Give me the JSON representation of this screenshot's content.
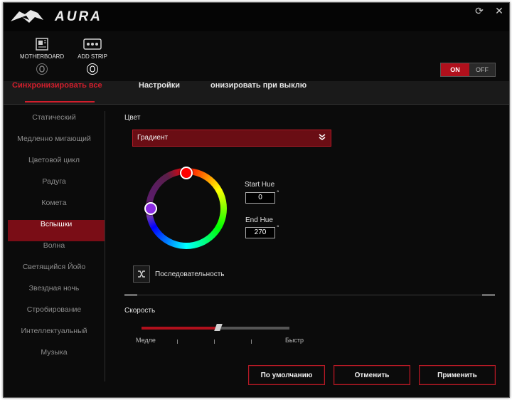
{
  "app": {
    "title": "AURA"
  },
  "devices": [
    {
      "label": "MOTHERBOARD",
      "icon": "motherboard-icon"
    },
    {
      "label": "ADD STRIP",
      "icon": "led-strip-icon"
    }
  ],
  "power": {
    "on": "ON",
    "off": "OFF",
    "state": "on"
  },
  "tabs": [
    {
      "label": "Синхронизировать все",
      "active": true
    },
    {
      "label": "Настройки",
      "active": false
    },
    {
      "label": "онизировать при выклю",
      "active": false
    }
  ],
  "sidebar": {
    "items": [
      {
        "label": "Статический"
      },
      {
        "label": "Медленно мигающий"
      },
      {
        "label": "Цветовой цикл"
      },
      {
        "label": "Радуга"
      },
      {
        "label": "Комета"
      },
      {
        "label": "Вспышки",
        "active": true
      },
      {
        "label": "Волна"
      },
      {
        "label": "Светящийся Йойо"
      },
      {
        "label": "Звездная ночь"
      },
      {
        "label": "Стробирование"
      },
      {
        "label": "Интеллектуальный"
      },
      {
        "label": "Музыка"
      }
    ]
  },
  "color": {
    "label": "Цвет",
    "mode": "Градиент",
    "start_hue_label": "Start Hue",
    "start_hue": "0",
    "end_hue_label": "End Hue",
    "end_hue": "270",
    "degree_symbol": "°"
  },
  "sequence": {
    "label": "Последовательность"
  },
  "speed": {
    "label": "Скорость",
    "min_label": "Медле",
    "max_label": "Быстр",
    "value_fraction": 0.5
  },
  "buttons": {
    "default": "По умолчанию",
    "cancel": "Отменить",
    "apply": "Применить"
  },
  "colors": {
    "accent": "#b0101c",
    "active_bg": "#7a0d16"
  }
}
